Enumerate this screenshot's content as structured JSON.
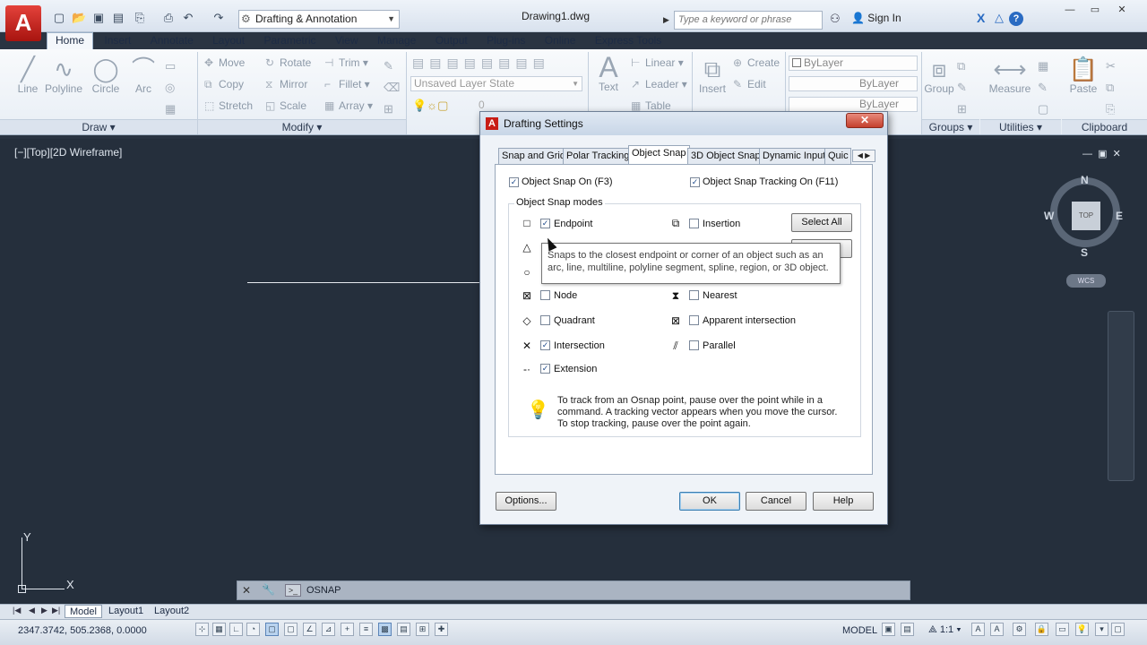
{
  "titlebar": {
    "app_letter": "A",
    "workspace": "Drafting & Annotation",
    "doc_title": "Drawing1.dwg",
    "search_placeholder": "Type a keyword or phrase",
    "signin": "Sign In",
    "help": "?"
  },
  "tabs": [
    "Home",
    "Insert",
    "Annotate",
    "Layout",
    "Parametric",
    "View",
    "Manage",
    "Output",
    "Plug-ins",
    "Online",
    "Express Tools"
  ],
  "ribbon": {
    "draw": {
      "line": "Line",
      "polyline": "Polyline",
      "circle": "Circle",
      "arc": "Arc",
      "panel": "Draw ▾"
    },
    "modify": {
      "move": "Move",
      "rotate": "Rotate",
      "trim": "Trim ▾",
      "copy": "Copy",
      "mirror": "Mirror",
      "fillet": "Fillet ▾",
      "stretch": "Stretch",
      "scale": "Scale",
      "array": "Array ▾",
      "panel": "Modify ▾"
    },
    "layers": {
      "state": "Unsaved Layer State",
      "zero": "0"
    },
    "annotation": {
      "text": "Text",
      "linear": "Linear ▾",
      "leader": "Leader ▾",
      "table": "Table"
    },
    "block": {
      "insert": "Insert",
      "create": "Create",
      "edit": "Edit"
    },
    "properties": {
      "bylayer1": "ByLayer",
      "bylayer2": "ByLayer",
      "bylayer3": "ByLayer"
    },
    "groups": {
      "group": "Group",
      "panel": "Groups ▾"
    },
    "utilities": {
      "measure": "Measure",
      "panel": "Utilities ▾"
    },
    "clipboard": {
      "paste": "Paste",
      "panel": "Clipboard"
    }
  },
  "viewport": {
    "label": "[−][Top][2D Wireframe]",
    "compass": {
      "n": "N",
      "s": "S",
      "e": "E",
      "w": "W",
      "top": "TOP"
    },
    "wcs": "WCS",
    "ucs_x": "X",
    "ucs_y": "Y"
  },
  "command": {
    "text": "OSNAP"
  },
  "layout_tabs": [
    "Model",
    "Layout1",
    "Layout2"
  ],
  "statusbar": {
    "coords": "2347.3742, 505.2368, 0.0000",
    "model": "MODEL",
    "scale": "1:1"
  },
  "dialog": {
    "title": "Drafting Settings",
    "tabs": [
      "Snap and Grid",
      "Polar Tracking",
      "Object Snap",
      "3D Object Snap",
      "Dynamic Input",
      "Quic"
    ],
    "osnap_on": "Object Snap On (F3)",
    "tracking_on": "Object Snap Tracking On (F11)",
    "modes_label": "Object Snap modes",
    "left_modes": [
      {
        "label": "Endpoint",
        "checked": "✓"
      },
      {
        "label": "Node",
        "checked": ""
      },
      {
        "label": "Quadrant",
        "checked": ""
      },
      {
        "label": "Intersection",
        "checked": "✓"
      },
      {
        "label": "Extension",
        "checked": "✓"
      }
    ],
    "right_modes": [
      {
        "label": "Insertion",
        "checked": ""
      },
      {
        "label": "Nearest",
        "checked": ""
      },
      {
        "label": "Apparent intersection",
        "checked": ""
      },
      {
        "label": "Parallel",
        "checked": ""
      }
    ],
    "select_all": "Select All",
    "tooltip": "Snaps to the closest endpoint or corner of an object such as an arc, line, multiline, polyline segment, spline, region, or 3D object.",
    "tip": "To track from an Osnap point, pause over the point while in a command.  A tracking vector appears when you move the cursor. To stop tracking, pause over the point again.",
    "options": "Options...",
    "ok": "OK",
    "cancel": "Cancel",
    "help": "Help",
    "close": "✕"
  }
}
